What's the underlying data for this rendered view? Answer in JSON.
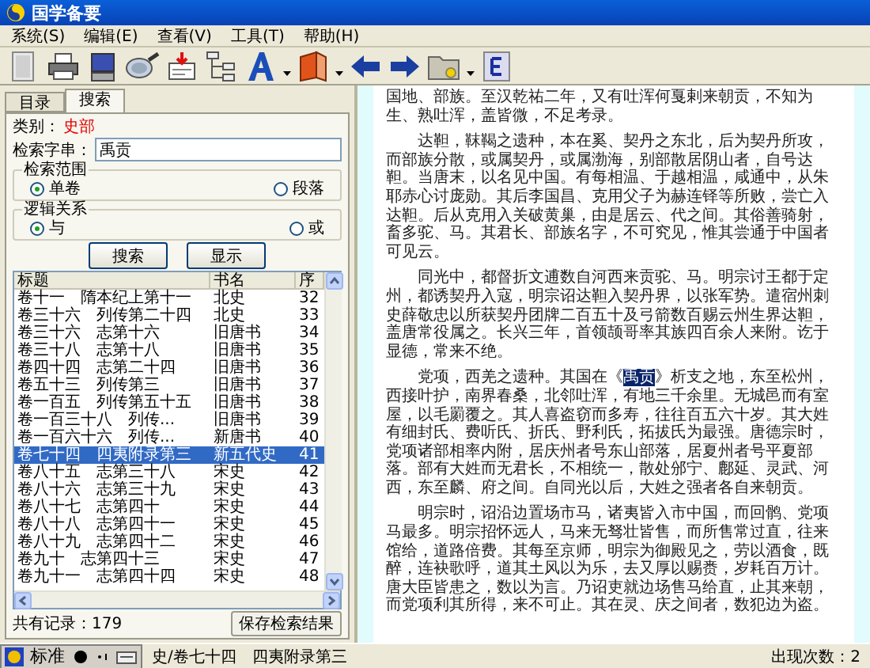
{
  "window": {
    "title": "国学备要"
  },
  "menu": [
    "系统(S)",
    "编辑(E)",
    "查看(V)",
    "工具(T)",
    "帮助(H)"
  ],
  "tabs": [
    {
      "label": "目录",
      "selected": false
    },
    {
      "label": "搜索",
      "selected": true
    }
  ],
  "search": {
    "category_label": "类别：",
    "category": "史部",
    "query_label": "检索字串：",
    "query": "禹贡",
    "groups": [
      {
        "title": "检索范围",
        "options": [
          {
            "label": "单卷",
            "selected": true
          },
          {
            "label": "段落",
            "selected": false
          }
        ]
      },
      {
        "title": "逻辑关系",
        "options": [
          {
            "label": "与",
            "selected": true
          },
          {
            "label": "或",
            "selected": false
          }
        ]
      }
    ],
    "buttons": [
      "搜索",
      "显示"
    ]
  },
  "results": {
    "columns": [
      "标题",
      "书名",
      "序"
    ],
    "rows": [
      {
        "title": "卷十一　隋本纪上第十一",
        "book": "北史",
        "index": "32",
        "selected": false
      },
      {
        "title": "卷三十六　列传第二十四",
        "book": "北史",
        "index": "33",
        "selected": false
      },
      {
        "title": "卷三十六　志第十六",
        "book": "旧唐书",
        "index": "34",
        "selected": false
      },
      {
        "title": "卷三十八　志第十八",
        "book": "旧唐书",
        "index": "35",
        "selected": false
      },
      {
        "title": "卷四十四　志第二十四",
        "book": "旧唐书",
        "index": "36",
        "selected": false
      },
      {
        "title": "卷五十三　列传第三",
        "book": "旧唐书",
        "index": "37",
        "selected": false
      },
      {
        "title": "卷一百五　列传第五十五",
        "book": "旧唐书",
        "index": "38",
        "selected": false
      },
      {
        "title": "卷一百三十八　列传...",
        "book": "旧唐书",
        "index": "39",
        "selected": false
      },
      {
        "title": "卷一百六十六　列传...",
        "book": "新唐书",
        "index": "40",
        "selected": false
      },
      {
        "title": "卷七十四　四夷附录第三",
        "book": "新五代史",
        "index": "41",
        "selected": true
      },
      {
        "title": "卷八十五　志第三十八",
        "book": "宋史",
        "index": "42",
        "selected": false
      },
      {
        "title": "卷八十六　志第三十九",
        "book": "宋史",
        "index": "43",
        "selected": false
      },
      {
        "title": "卷八十七　志第四十",
        "book": "宋史",
        "index": "44",
        "selected": false
      },
      {
        "title": "卷八十八　志第四十一",
        "book": "宋史",
        "index": "45",
        "selected": false
      },
      {
        "title": "卷八十九　志第四十二",
        "book": "宋史",
        "index": "46",
        "selected": false
      },
      {
        "title": "卷九十　志第四十三",
        "book": "宋史",
        "index": "47",
        "selected": false
      },
      {
        "title": "卷九十一　志第四十四",
        "book": "宋史",
        "index": "48",
        "selected": false
      }
    ],
    "count": "共有记录：179",
    "save_button": "保存检索结果"
  },
  "text": {
    "paragraphs": [
      {
        "before": "国地、部族。至汉乾祐二年，又有吐浑何戛剌来朝贡，不知为生、熟吐浑，盖皆微，不足考录。"
      },
      {
        "before": "达靼，靺鞨之遗种，本在奚、契丹之东北，后为契丹所攻，而部族分散，或属契丹，或属渤海，别部散居阴山者，自号达靼。当唐末，以名见中国。有每相温、于越相温，咸通中，从朱耶赤心讨庞勋。其后李国昌、克用父子为赫连铎等所败，尝亡入达靼。后从克用入关破黄巢，由是居云、代之间。其俗善骑射，畜多驼、马。其君长、部族名字，不可究见，惟其尝通于中国者可见云。"
      },
      {
        "before": "同光中，都督折文逋数自河西来贡驼、马。明宗讨王都于定州，都诱契丹入寇，明宗诏达靼入契丹界，以张军势。遣宿州刺史薛敬忠以所获契丹团牌二百五十及弓箭数百赐云州生界达靼，盖唐常役属之。长兴三年，首领颉哥率其族四百余人来附。讫于显德，常来不绝。"
      },
      {
        "before": "党项，西羌之遗种。其国在《",
        "highlight": "禹贡",
        "after": "》析支之地，东至松州，西接叶护，南界春桑，北邻吐浑，有地三千余里。无城邑而有室屋，以毛罽覆之。其人喜盗窃而多寿，往往百五六十岁。其大姓有细封氏、费听氏、折氏、野利氏，拓拔氏为最强。唐德宗时，党项诸部相率内附，居庆州者号东山部落，居夏州者号平夏部落。部有大姓而无君长，不相统一，散处邠宁、鄜延、灵武、河西，东至麟、府之间。自同光以后，大姓之强者各自来朝贡。"
      },
      {
        "before": "明宗时，诏沿边置场市马，诸夷皆入市中国，而回鹘、党项马最多。明宗招怀远人，马来无驽壮皆售，而所售常过直，往来馆给，道路倍费。其每至京师，明宗为御殿见之，劳以酒食，既醉，连袂歌呼，道其土风以为乐，去又厚以赐赉，岁耗百万计。唐大臣皆患之，数以为言。乃诏吏就边场售马给直，止其来朝，而党项利其所得，来不可止。其在灵、庆之间者，数犯边为盗。"
      }
    ]
  },
  "status": {
    "ime": "标准",
    "location": "史/卷七十四　四夷附录第三",
    "hits": "出现次数：2"
  }
}
